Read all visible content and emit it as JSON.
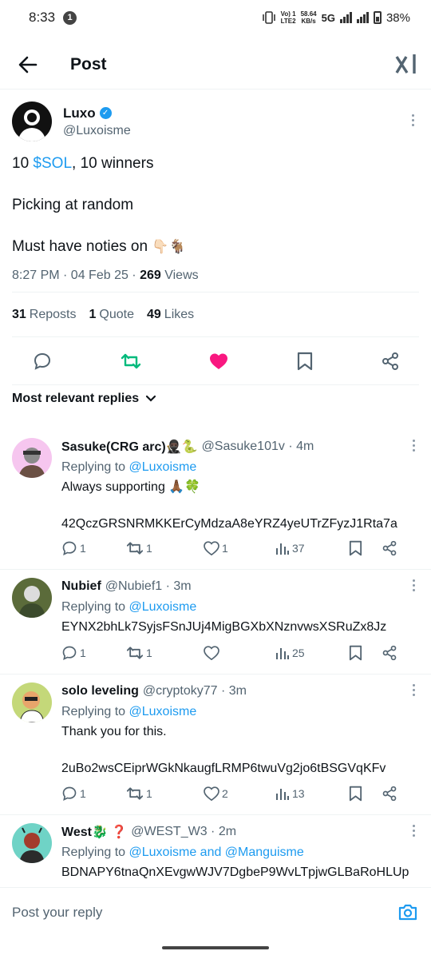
{
  "status": {
    "time": "8:33",
    "notif_count": "1",
    "net_line1": "Vo) 1",
    "net_line2": "LTE2",
    "speed_line1": "58.64",
    "speed_line2": "KB/s",
    "net_type": "5G",
    "battery": "38%"
  },
  "header": {
    "title": "Post"
  },
  "tweet": {
    "author_name": "Luxo",
    "author_handle": "@Luxoisme",
    "line1_pre": "10 ",
    "line1_link": "$SOL",
    "line1_post": ", 10 winners",
    "line2": "Picking at random",
    "line3": "Must have noties on",
    "line3_emoji": "👇🏻🐐",
    "meta_time": "8:27 PM · 04 Feb 25 · ",
    "meta_views_count": "269",
    "meta_views_label": " Views",
    "reposts_count": "31",
    "reposts_label": "Reposts",
    "quotes_count": "1",
    "quotes_label": "Quote",
    "likes_count": "49",
    "likes_label": "Likes",
    "colors": {
      "repost": "#00ba7c",
      "like": "#f91880",
      "link": "#1d9bf0"
    }
  },
  "replies_sort": "Most relevant replies",
  "replies": [
    {
      "name": "Sasuke(CRG arc)🥷🏿🐍",
      "handle": "@Sasuke101v",
      "time": "· 4m",
      "replying_prefix": "Replying to ",
      "replying_to": "@Luxoisme",
      "text1": "Always supporting 🙏🏾🍀",
      "text2": "",
      "text3": "42QczGRSNRMKKErCyMdzaA8eYRZ4yeUTrZFyzJ1Rta7a",
      "replies": "1",
      "reposts": "1",
      "likes": "1",
      "views": "37"
    },
    {
      "name": "Nubief",
      "handle": "@Nubief1",
      "time": "· 3m",
      "replying_prefix": "Replying to ",
      "replying_to": "@Luxoisme",
      "text1": "EYNX2bhLk7SyjsFSnJUj4MigBGXbXNznvwsXSRuZx8Jz",
      "replies": "1",
      "reposts": "1",
      "likes": "",
      "views": "25"
    },
    {
      "name": "solo leveling",
      "handle": "@cryptoky77",
      "time": "· 3m",
      "replying_prefix": "Replying to ",
      "replying_to": "@Luxoisme",
      "text1": "Thank you for this.",
      "text2": "",
      "text3": "2uBo2wsCEiprWGkNkaugfLRMP6twuVg2jo6tBSGVqKFv",
      "replies": "1",
      "reposts": "1",
      "likes": "2",
      "views": "13"
    },
    {
      "name": "West🐉 ❓",
      "handle": "@WEST_W3",
      "time": "· 2m",
      "replying_prefix": "Replying to ",
      "replying_to": "@Luxoisme and @Manguisme",
      "text1": "BDNAPY6tnaQnXEvgwWJV7DgbeP9WvLTpjwGLBaRoHLUp"
    }
  ],
  "composer": {
    "placeholder": "Post your reply"
  }
}
